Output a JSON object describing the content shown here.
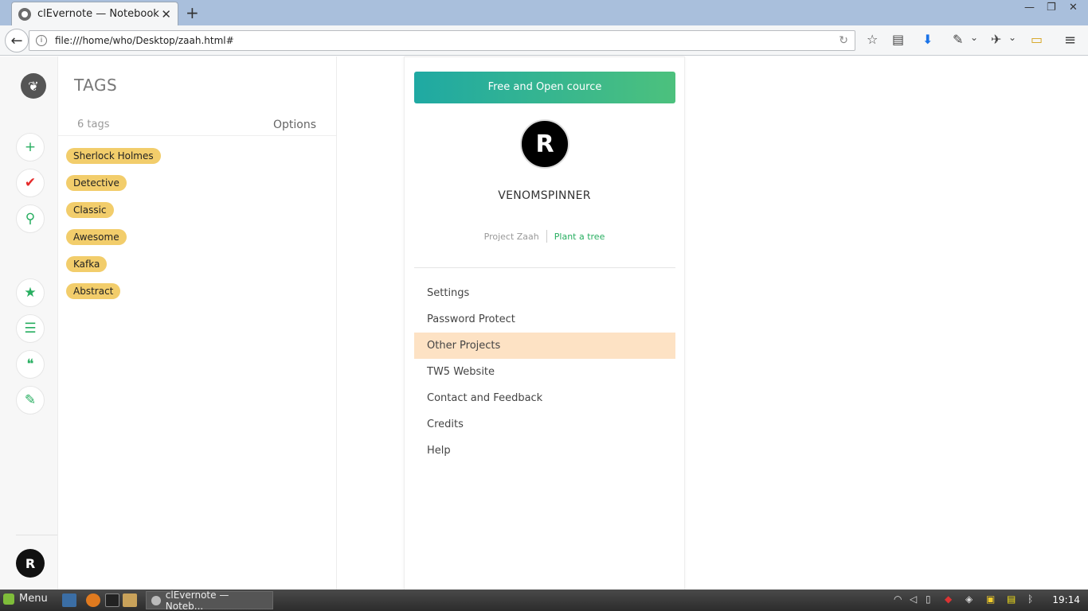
{
  "browser": {
    "tab_title": "clEvernote — Notebook",
    "tab_close": "✕",
    "new_tab": "+",
    "url": "file:///home/who/Desktop/zaah.html#",
    "window_controls": [
      "—",
      "❐",
      "✕"
    ]
  },
  "rail": {
    "buttons": [
      {
        "icon": "plus-icon",
        "glyph": "+"
      },
      {
        "icon": "check-icon",
        "glyph": "✔"
      },
      {
        "icon": "search-icon",
        "glyph": "⚲"
      },
      {
        "icon": "star-icon",
        "glyph": "★"
      },
      {
        "icon": "notebook-icon",
        "glyph": "☰"
      },
      {
        "icon": "quote-icon",
        "glyph": "❝"
      },
      {
        "icon": "tag-icon",
        "glyph": "✎"
      }
    ],
    "avatar_glyph": "R"
  },
  "tags_panel": {
    "title": "TAGS",
    "count_text": "6 tags",
    "options_label": "Options",
    "tags": [
      "Sherlock Holmes",
      "Detective",
      "Classic",
      "Awesome",
      "Kafka",
      "Abstract"
    ]
  },
  "card": {
    "banner_text": "Free and Open cource",
    "avatar_glyph": "R",
    "name": "VENOMSPINNER",
    "project_label": "Project Zaah",
    "plant_label": "Plant a tree",
    "menu": [
      {
        "label": "Settings",
        "active": false
      },
      {
        "label": "Password Protect",
        "active": false
      },
      {
        "label": "Other Projects",
        "active": true
      },
      {
        "label": "TW5 Website",
        "active": false
      },
      {
        "label": "Contact and Feedback",
        "active": false
      },
      {
        "label": "Credits",
        "active": false
      },
      {
        "label": "Help",
        "active": false
      }
    ]
  },
  "taskbar": {
    "menu_label": "Menu",
    "window_label": "clEvernote — Noteb...",
    "clock": "19:14"
  },
  "colors": {
    "accent_green": "#27ae60",
    "tag_yellow": "#f2cd6b",
    "active_item": "#fde2c4"
  }
}
